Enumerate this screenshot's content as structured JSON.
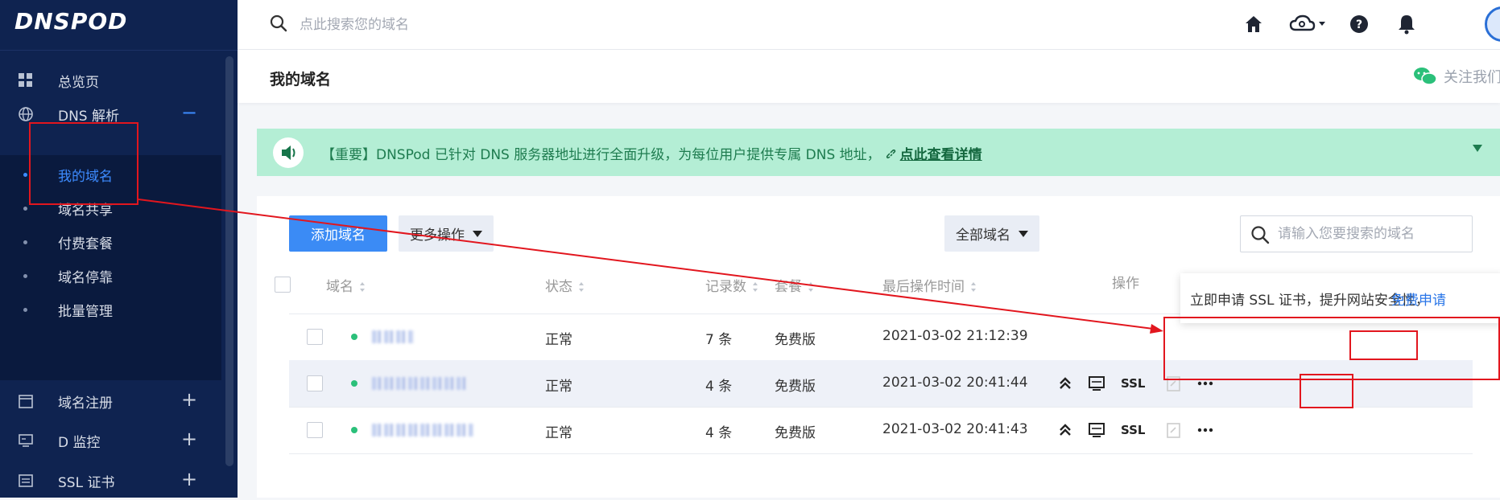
{
  "app": {
    "brand": "DNSPOD"
  },
  "sidebar": {
    "items": [
      {
        "label": "总览页",
        "icon": "dashboard-grid-icon"
      },
      {
        "label": "DNS 解析",
        "icon": "globe-icon",
        "toggle": "−"
      },
      {
        "label": "域名注册",
        "icon": "calendar-icon",
        "toggle": "+"
      },
      {
        "label": "D 监控",
        "icon": "monitor-icon",
        "toggle": "+"
      },
      {
        "label": "SSL 证书",
        "icon": "certificate-icon",
        "toggle": "+"
      }
    ],
    "dns_submenu": [
      "我的域名",
      "域名共享",
      "付费套餐",
      "域名停靠",
      "批量管理"
    ]
  },
  "topbar": {
    "search_placeholder": "点此搜索您的域名",
    "icons": [
      "home-icon",
      "cloud-settings-icon",
      "help-icon",
      "bell-icon",
      "avatar"
    ]
  },
  "page": {
    "title": "我的域名",
    "follow_text": "关注我们"
  },
  "notice": {
    "text": "【重要】DNSPod 已针对 DNS 服务器地址进行全面升级，为每位用户提供专属 DNS 地址，",
    "link": "点此查看详情"
  },
  "toolbar": {
    "add_label": "添加域名",
    "more_label": "更多操作",
    "filter_label": "全部域名",
    "search_placeholder": "请输入您要搜索的域名"
  },
  "table": {
    "headers": [
      "域名",
      "状态",
      "记录数",
      "套餐",
      "最后操作时间",
      "操作"
    ],
    "rows": [
      {
        "status": "正常",
        "records": "7 条",
        "plan": "免费版",
        "updated": "2021-03-02 21:12:39"
      },
      {
        "status": "正常",
        "records": "4 条",
        "plan": "免费版",
        "updated": "2021-03-02 20:41:44"
      },
      {
        "status": "正常",
        "records": "4 条",
        "plan": "免费版",
        "updated": "2021-03-02 20:41:43"
      }
    ],
    "ssl_label": "SSL"
  },
  "tooltip": {
    "text": "立即申请 SSL 证书，提升网站安全性，",
    "link": "免费申请"
  },
  "colors": {
    "sidebar": "#0f2350",
    "accent": "#3b8bf5",
    "notice_bg": "#b4eed5",
    "annotation": "#e2161e"
  }
}
